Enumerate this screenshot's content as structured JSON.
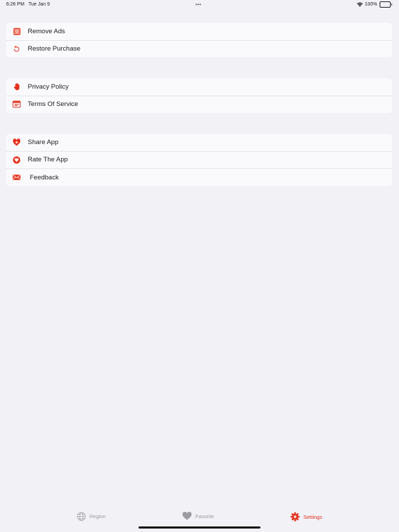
{
  "status_bar": {
    "time": "6:26 PM",
    "date": "Tue Jan 9",
    "battery": "100%",
    "dots": "•••"
  },
  "groups": [
    {
      "items": [
        {
          "label": "Remove Ads",
          "icon": "remove-ads-icon"
        },
        {
          "label": "Restore Purchase",
          "icon": "restore-icon"
        }
      ]
    },
    {
      "items": [
        {
          "label": "Privacy Policy",
          "icon": "hand-stop-icon"
        },
        {
          "label": "Terms Of Service",
          "icon": "document-icon"
        }
      ]
    },
    {
      "items": [
        {
          "label": "Share App",
          "icon": "heart-plus-icon"
        },
        {
          "label": "Rate The App",
          "icon": "heart-badge-icon"
        },
        {
          "label": "Feedback",
          "icon": "mail-icon"
        }
      ]
    }
  ],
  "tabs": [
    {
      "label": "Region",
      "icon": "globe-icon",
      "active": false
    },
    {
      "label": "Favorite",
      "icon": "heart-icon",
      "active": false
    },
    {
      "label": "Settings",
      "icon": "gear-icon",
      "active": true
    }
  ],
  "colors": {
    "accent": "#e5321c",
    "background": "#f1f1f6",
    "cell": "#fafafc",
    "inactive_tab": "#9c9ca2"
  }
}
